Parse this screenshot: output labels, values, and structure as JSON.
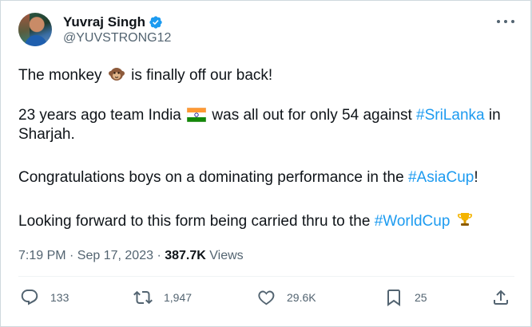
{
  "author": {
    "name": "Yuvraj Singh",
    "handle": "@YUVSTRONG12",
    "verified": true
  },
  "tweet": {
    "line1_a": "The monkey",
    "line1_b": "is finally off our back!",
    "line2_a": "23 years ago team India",
    "line2_b": "was all out for only 54 against",
    "line2_tag": "#SriLanka",
    "line2_c": "in",
    "line2_d": "Sharjah.",
    "line3_a": "Congratulations boys on a dominating performance in the",
    "line3_tag": "#AsiaCup",
    "line3_b": "!",
    "line4_a": "Looking forward to this form being carried thru to the",
    "line4_tag": "#WorldCup"
  },
  "meta": {
    "time": "7:19 PM · Sep 17, 2023 ·",
    "views_count": "387.7K",
    "views_label": "Views"
  },
  "actions": {
    "replies": "133",
    "retweets": "1,947",
    "likes": "29.6K",
    "bookmarks": "25"
  },
  "colors": {
    "hashtag": "#1d9bf0",
    "verified": "#1d9bf0",
    "secondary_text": "#536471"
  },
  "icons": [
    "verified-badge-icon",
    "more-icon",
    "monkey-emoji",
    "india-flag-emoji",
    "trophy-emoji",
    "reply-icon",
    "retweet-icon",
    "like-icon",
    "bookmark-icon",
    "share-icon"
  ]
}
